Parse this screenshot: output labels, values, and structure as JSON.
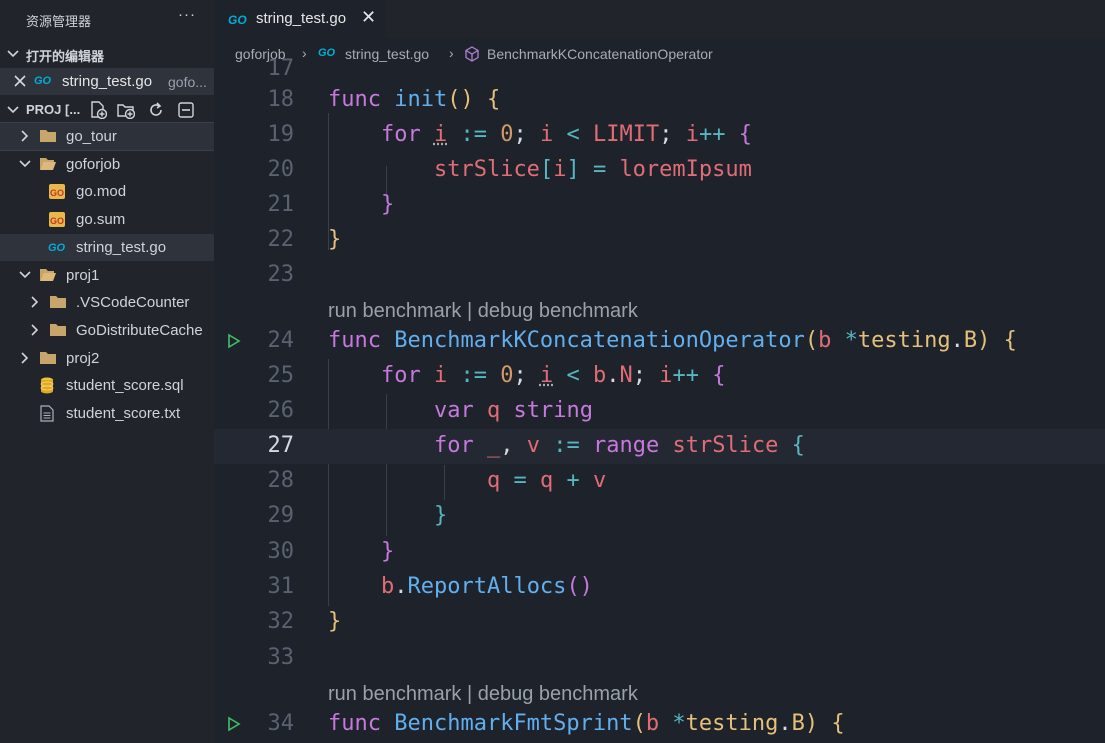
{
  "sidebar": {
    "title": "资源管理器",
    "more": "···",
    "open_editors_label": "打开的编辑器",
    "open_editor": {
      "name": "string_test.go",
      "dir": "gofo..."
    },
    "project_label": "PROJ [...",
    "tree": [
      {
        "label": "go_tour"
      },
      {
        "label": "goforjob"
      },
      {
        "label": "go.mod"
      },
      {
        "label": "go.sum"
      },
      {
        "label": "string_test.go"
      },
      {
        "label": "proj1"
      },
      {
        "label": ".VSCodeCounter"
      },
      {
        "label": "GoDistributeCache"
      },
      {
        "label": "proj2"
      },
      {
        "label": "student_score.sql"
      },
      {
        "label": "student_score.txt"
      }
    ]
  },
  "tabs": [
    {
      "label": "string_test.go",
      "close": "✕"
    }
  ],
  "breadcrumb": {
    "folder": "goforjob",
    "file": "string_test.go",
    "symbol": "BenchmarkKConcatenationOperator"
  },
  "editor": {
    "line_numbers": {
      "l17": "17",
      "l18": "18",
      "l19": "19",
      "l20": "20",
      "l21": "21",
      "l22": "22",
      "l23": "23",
      "l24": "24",
      "l25": "25",
      "l26": "26",
      "l27": "27",
      "l28": "28",
      "l29": "29",
      "l30": "30",
      "l31": "31",
      "l32": "32",
      "l33": "33",
      "l34": "34"
    },
    "codelens_1": "run benchmark | debug benchmark",
    "codelens_2": "run benchmark | debug benchmark",
    "tokens": {
      "func": "func",
      "init": "init",
      "for": "for",
      "i": "i",
      "assign": ":=",
      "zero": "0",
      "lt": "<",
      "limit": "LIMIT",
      "inc": "++",
      "strslice": "strSlice",
      "eq": "=",
      "lorem": "loremIpsum",
      "bench1": "BenchmarkKConcatenationOperator",
      "b": "b",
      "testing": "testing",
      "B": "B",
      "N": "N",
      "var": "var",
      "q": "q",
      "string": "string",
      "underscore": "_",
      "v": "v",
      "range": "range",
      "plus": "+",
      "reportallocs": "ReportAllocs",
      "bench2": "BenchmarkFmtSprint"
    }
  }
}
